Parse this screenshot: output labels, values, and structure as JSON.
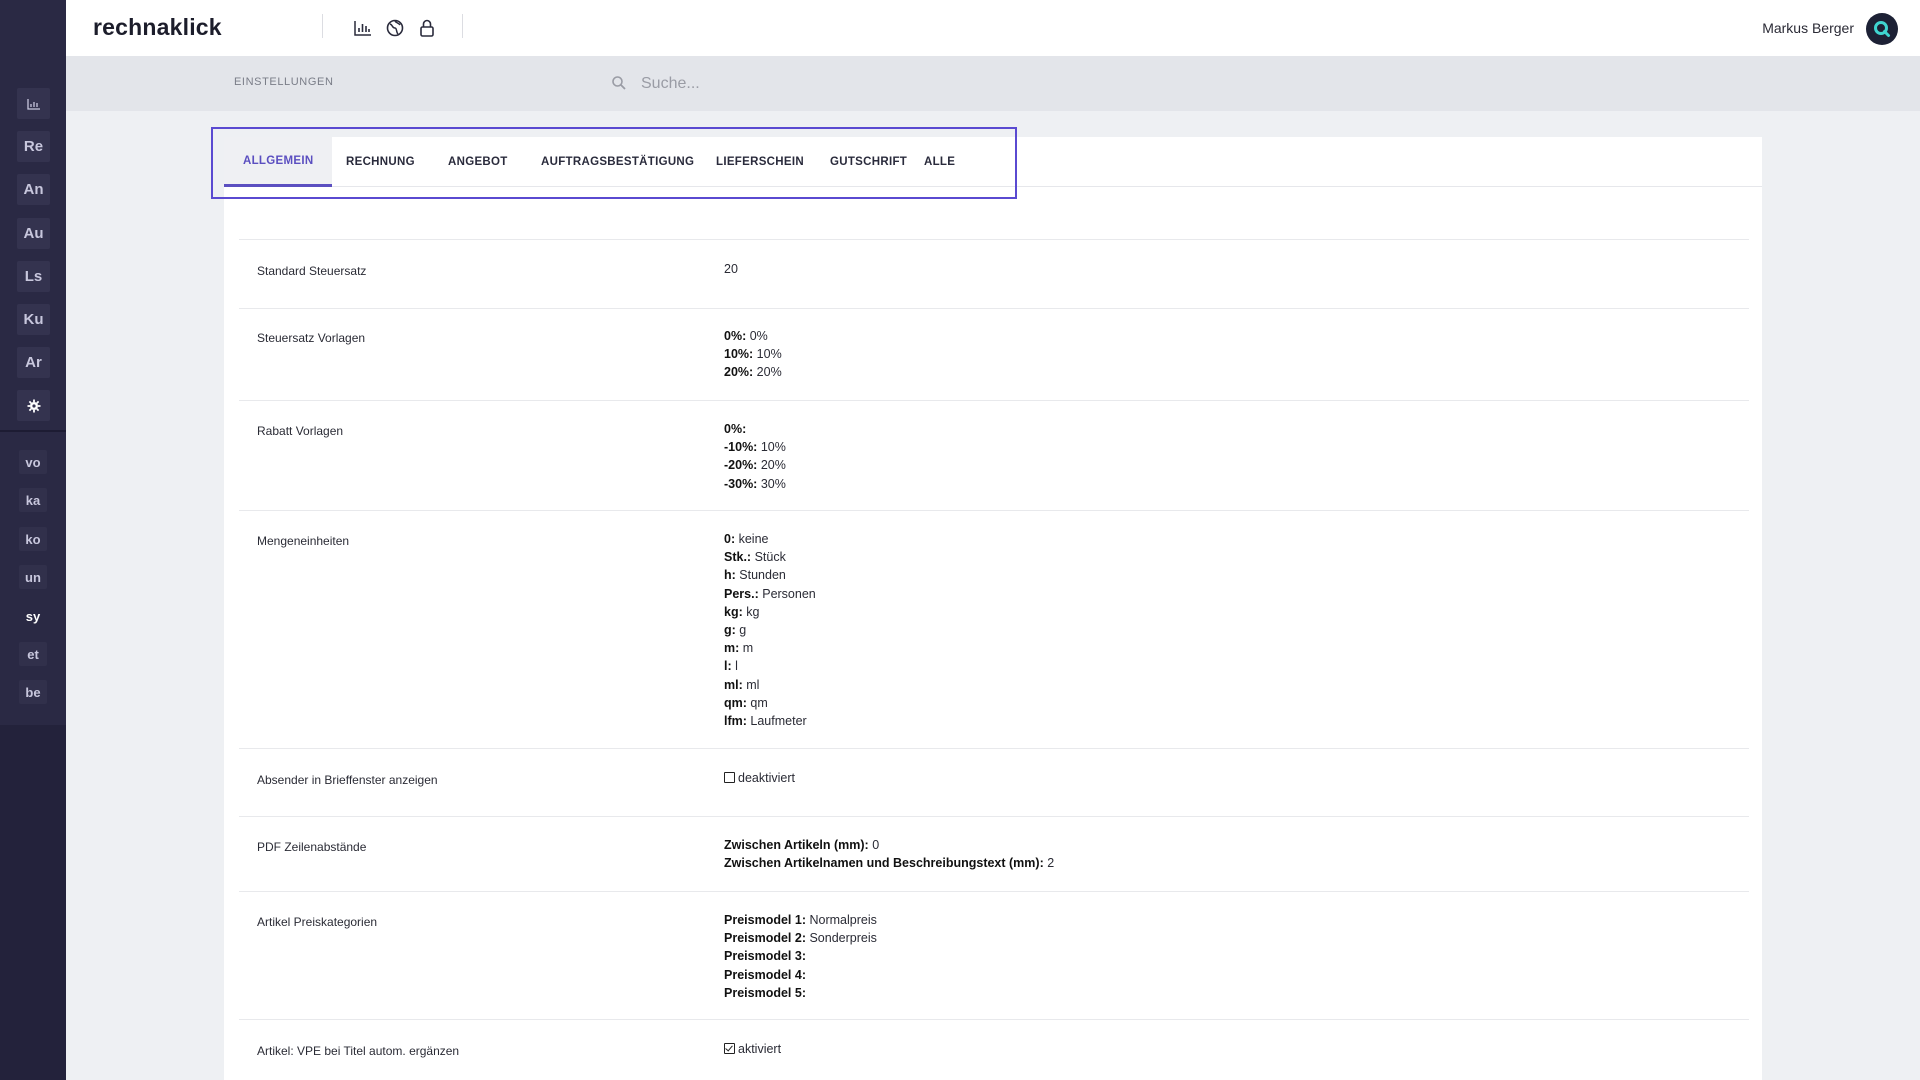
{
  "app": {
    "logo": "rechnaklick",
    "user_name": "Markus Berger"
  },
  "sidebar": {
    "items": [
      {
        "label": "",
        "icon": "chart-icon"
      },
      {
        "label": "Re"
      },
      {
        "label": "An"
      },
      {
        "label": "Au"
      },
      {
        "label": "Ls"
      },
      {
        "label": "Ku"
      },
      {
        "label": "Ar"
      },
      {
        "label": "",
        "icon": "gear-icon"
      }
    ],
    "small_items": [
      {
        "label": "vo"
      },
      {
        "label": "ka"
      },
      {
        "label": "ko"
      },
      {
        "label": "un"
      },
      {
        "label": "sy"
      },
      {
        "label": "et"
      },
      {
        "label": "be"
      }
    ]
  },
  "subbar": {
    "breadcrumb": "EINSTELLUNGEN",
    "search_placeholder": "Suche..."
  },
  "tabs": [
    {
      "label": "ALLGEMEIN",
      "active": true
    },
    {
      "label": "RECHNUNG"
    },
    {
      "label": "ANGEBOT"
    },
    {
      "label": "AUFTRAGSBESTÄTIGUNG"
    },
    {
      "label": "LIEFERSCHEIN"
    },
    {
      "label": "GUTSCHRIFT"
    },
    {
      "label": "ALLE"
    }
  ],
  "settings": {
    "standard_steuersatz": {
      "label": "Standard Steuersatz",
      "value": "20"
    },
    "steuersatz_vorlagen": {
      "label": "Steuersatz Vorlagen",
      "items": [
        {
          "key": "0%:",
          "value": "0%"
        },
        {
          "key": "10%:",
          "value": "10%"
        },
        {
          "key": "20%:",
          "value": "20%"
        }
      ]
    },
    "rabatt_vorlagen": {
      "label": "Rabatt Vorlagen",
      "items": [
        {
          "key": "0%:",
          "value": ""
        },
        {
          "key": "-10%:",
          "value": "10%"
        },
        {
          "key": "-20%:",
          "value": "20%"
        },
        {
          "key": "-30%:",
          "value": "30%"
        }
      ]
    },
    "mengeneinheiten": {
      "label": "Mengeneinheiten",
      "items": [
        {
          "key": "0:",
          "value": "keine"
        },
        {
          "key": "Stk.:",
          "value": "Stück"
        },
        {
          "key": "h:",
          "value": "Stunden"
        },
        {
          "key": "Pers.:",
          "value": "Personen"
        },
        {
          "key": "kg:",
          "value": "kg"
        },
        {
          "key": "g:",
          "value": "g"
        },
        {
          "key": "m:",
          "value": "m"
        },
        {
          "key": "l:",
          "value": "l"
        },
        {
          "key": "ml:",
          "value": "ml"
        },
        {
          "key": "qm:",
          "value": "qm"
        },
        {
          "key": "lfm:",
          "value": "Laufmeter"
        }
      ]
    },
    "absender": {
      "label": "Absender in Brieffenster anzeigen",
      "checked": false,
      "value": "deaktiviert"
    },
    "pdf_zeilenabstaende": {
      "label": "PDF Zeilenabstände",
      "items": [
        {
          "key": "Zwischen Artikeln (mm):",
          "value": "0"
        },
        {
          "key": "Zwischen Artikelnamen und Beschreibungstext (mm):",
          "value": "2"
        }
      ]
    },
    "preiskategorien": {
      "label": "Artikel Preiskategorien",
      "items": [
        {
          "key": "Preismodel 1:",
          "value": "Normalpreis"
        },
        {
          "key": "Preismodel 2:",
          "value": "Sonderpreis"
        },
        {
          "key": "Preismodel 3:",
          "value": ""
        },
        {
          "key": "Preismodel 4:",
          "value": ""
        },
        {
          "key": "Preismodel 5:",
          "value": ""
        }
      ]
    },
    "vpe": {
      "label": "Artikel: VPE bei Titel autom. ergänzen",
      "checked": true,
      "value": "aktiviert"
    }
  },
  "colors": {
    "accent": "#5b4fc0",
    "sidebar_bg": "#23223b",
    "highlight_border": "#5a4ad1"
  }
}
